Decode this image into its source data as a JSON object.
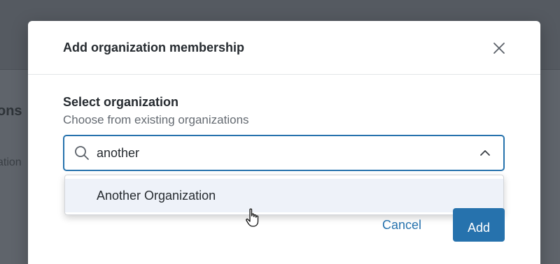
{
  "background": {
    "title_fragment": "ons",
    "subtitle_fragment": "ation"
  },
  "modal": {
    "title": "Add organization membership",
    "close_icon": "close-icon"
  },
  "form": {
    "label": "Select organization",
    "help": "Choose from existing organizations",
    "search_value": "another",
    "search_icon": "search-icon",
    "toggle_icon": "chevron-up-icon",
    "options": [
      {
        "label": "Another Organization"
      }
    ]
  },
  "actions": {
    "cancel_label": "Cancel",
    "add_label": "Add"
  },
  "colors": {
    "accent": "#2672ad",
    "option_hover": "#eef2f9"
  }
}
